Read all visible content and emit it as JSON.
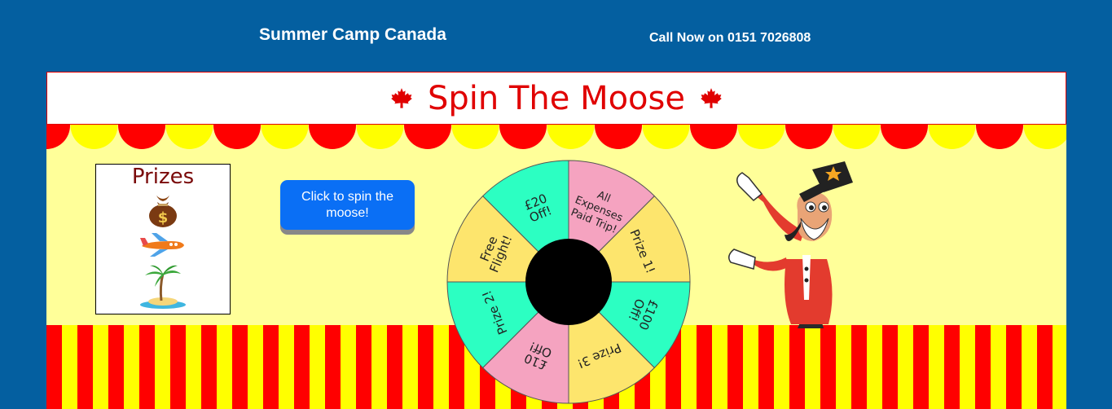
{
  "site": {
    "title": "Summer Camp Canada",
    "phone": "Call Now on 0151 7026808"
  },
  "game": {
    "title": "Spin The Moose",
    "prizes_title": "Prizes",
    "prize_icons": [
      "money-bag-icon",
      "airplane-icon",
      "island-icon"
    ],
    "spin_button_label": "Click to spin the moose!",
    "wheel_segments": [
      {
        "lines": [
          "All",
          "Expenses",
          "Paid Trip!"
        ],
        "color": "#f5a3c0"
      },
      {
        "lines": [
          "Prize 1!"
        ],
        "color": "#fde56d"
      },
      {
        "lines": [
          "£100",
          "Off!"
        ],
        "color": "#2cffc2"
      },
      {
        "lines": [
          "Prize 3!"
        ],
        "color": "#fde56d"
      },
      {
        "lines": [
          "£10",
          "Off!"
        ],
        "color": "#f5a3c0"
      },
      {
        "lines": [
          "Prize 2!"
        ],
        "color": "#2cffc2"
      },
      {
        "lines": [
          "Free",
          "Flight!"
        ],
        "color": "#fde56d"
      },
      {
        "lines": [
          "£20",
          "Off!"
        ],
        "color": "#2cffc2"
      }
    ]
  },
  "colors": {
    "page_background": "#045fa0",
    "title_red": "#e00000",
    "canopy_red": "#ff0000",
    "canopy_yellow": "#ffff00",
    "panel_yellow": "#ffff99",
    "button_blue": "#0a6ff5"
  }
}
